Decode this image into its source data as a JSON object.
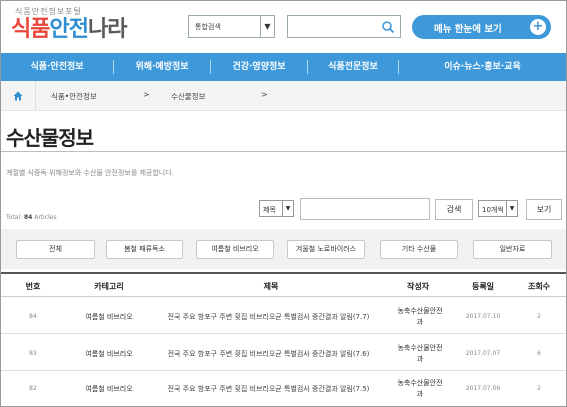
{
  "header": {
    "logo_sub": "식품안전정보포털",
    "logo_part1": "식품",
    "logo_part2": "안전",
    "logo_part3": "나라",
    "search_scope": "통합검색",
    "search_placeholder": "",
    "menu_button": "메뉴 한눈에 보기",
    "menu_button_plus": "+"
  },
  "nav": {
    "items": [
      {
        "label": "식품·안전정보"
      },
      {
        "label": "위해·예방정보"
      },
      {
        "label": "건강·영양정보"
      },
      {
        "label": "식품전문정보"
      },
      {
        "label": "이슈·뉴스·홍보·교육"
      }
    ]
  },
  "breadcrumb": {
    "level1": "식품•안전정보",
    "level2": "수산물정보",
    "arrow": ">"
  },
  "page": {
    "title": "수산물정보",
    "description": "계절별 식중독 위해정보와 수산물 안전정보를 제공합니다."
  },
  "search_bar": {
    "total_prefix": "Total: ",
    "total_count": "84",
    "total_suffix": " Articles",
    "field_select": "제목",
    "keyword_value": "",
    "search_button": "검색",
    "count_select": "10개씩",
    "view_button": "보기"
  },
  "categories": [
    {
      "label": "전체"
    },
    {
      "label": "봄철 패류독소"
    },
    {
      "label": "여름철 비브리오"
    },
    {
      "label": "겨울철 노로바이러스"
    },
    {
      "label": "기타 수산물"
    },
    {
      "label": "일반자료"
    }
  ],
  "table": {
    "headers": {
      "no": "번호",
      "category": "카테고리",
      "title": "제목",
      "author": "작성자",
      "date": "등록일",
      "views": "조회수"
    },
    "rows": [
      {
        "no": "84",
        "category": "여름철 비브리오",
        "title": "전국 주요 항포구 주변 횟집 비브리오균 특별검사 중간결과 알림(7.7)",
        "author_line1": "농축수산물안전",
        "author_line2": "과",
        "date": "2017.07.10",
        "views": "2"
      },
      {
        "no": "83",
        "category": "여름철 비브리오",
        "title": "전국 주요 항포구 주변 횟집 비브리오균 특별검사 중간결과 알림(7.6)",
        "author_line1": "농축수산물안전",
        "author_line2": "과",
        "date": "2017.07.07",
        "views": "6"
      },
      {
        "no": "82",
        "category": "여름철 비브리오",
        "title": "전국 주요 항포구 주변 횟집 비브리오균 특별검사 중간결과 알림(7.5)",
        "author_line1": "농축수산물안전",
        "author_line2": "과",
        "date": "2017.07.06",
        "views": "2"
      }
    ]
  },
  "colors": {
    "primary": "#3d99d9",
    "logo_red": "#e8463a",
    "logo_blue": "#2f8fd1"
  }
}
